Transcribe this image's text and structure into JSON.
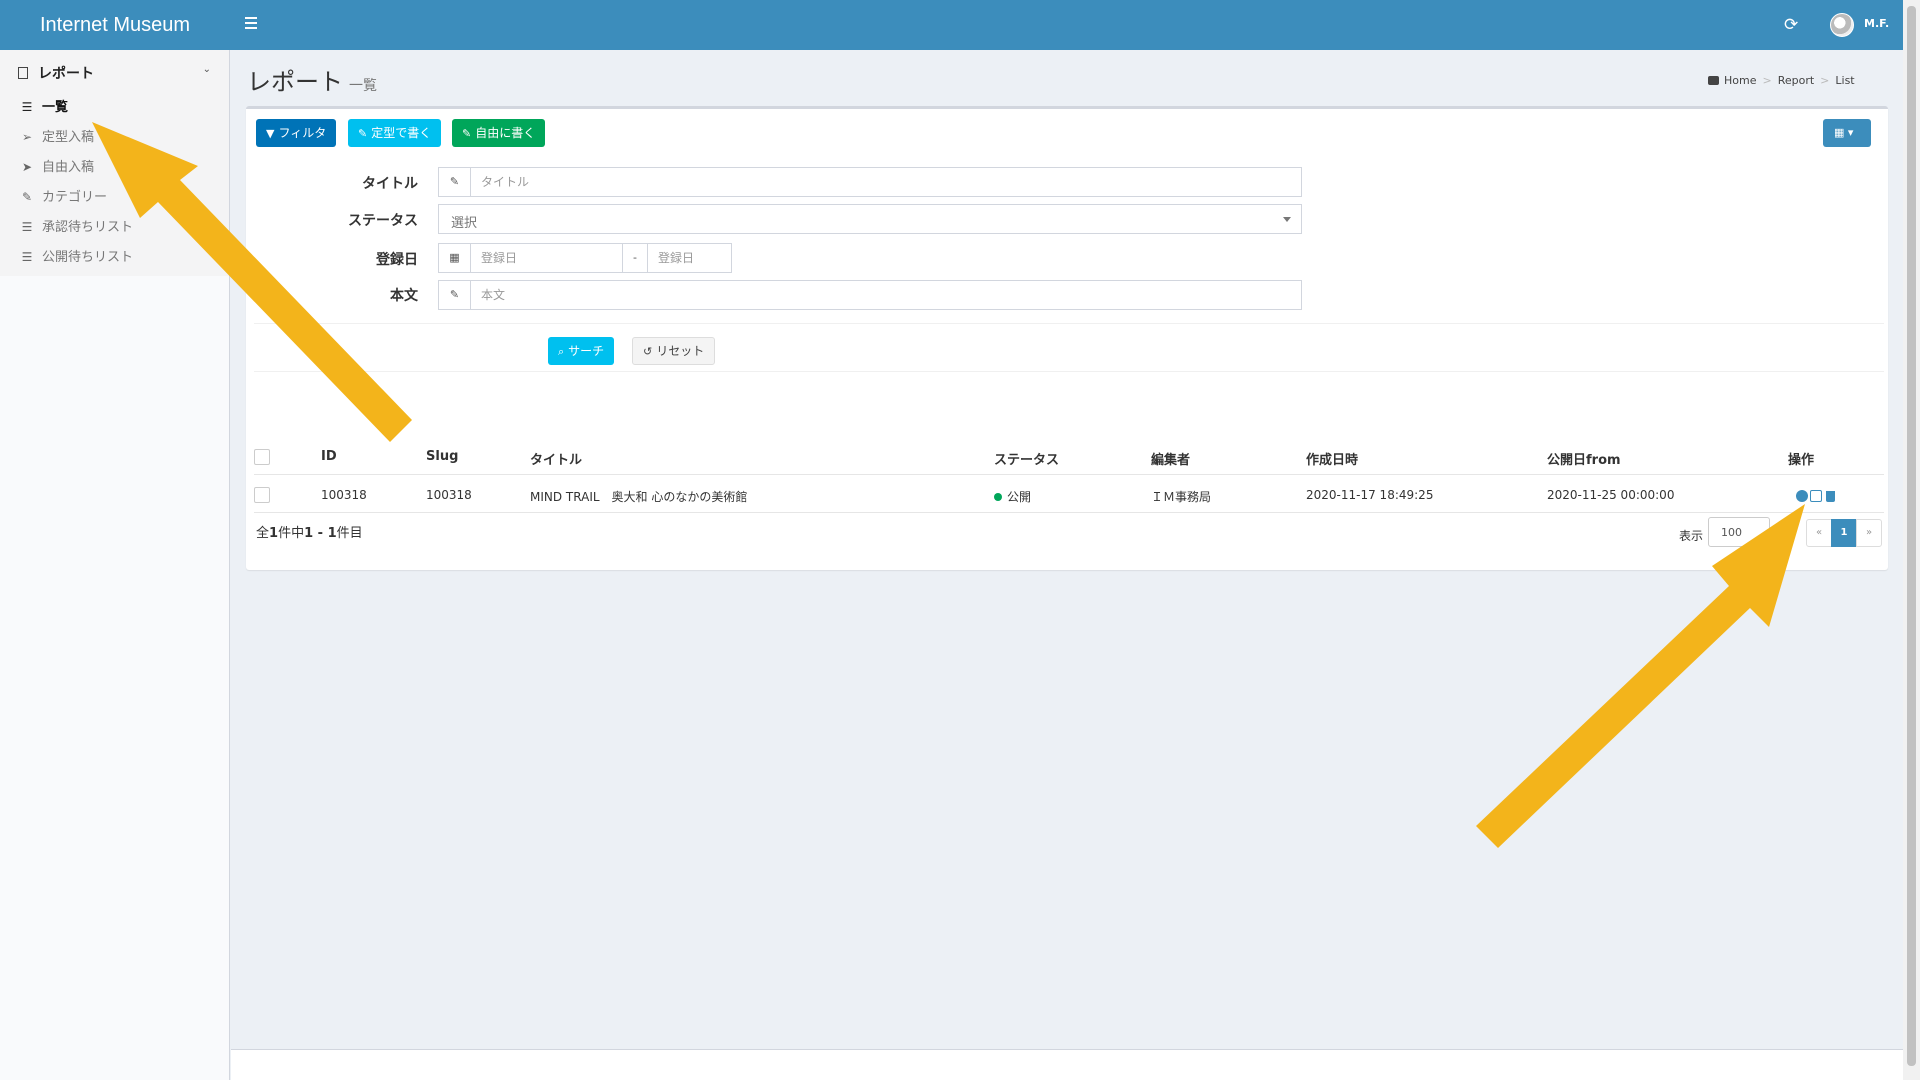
{
  "app": {
    "title": "Internet Museum",
    "user": "M.F."
  },
  "sidebar": {
    "section": "レポート",
    "items": [
      {
        "label": "一覧",
        "icon": "list-icon",
        "active": true
      },
      {
        "label": "定型入稿",
        "icon": "paper-plane-outline-icon"
      },
      {
        "label": "自由入稿",
        "icon": "paper-plane-icon"
      },
      {
        "label": "カテゴリー",
        "icon": "pencil-icon"
      },
      {
        "label": "承認待ちリスト",
        "icon": "list-icon"
      },
      {
        "label": "公開待ちリスト",
        "icon": "list-icon"
      }
    ]
  },
  "page": {
    "title": "レポート",
    "subtitle": "一覧"
  },
  "breadcrumb": [
    "Home",
    "Report",
    "List"
  ],
  "toolbar": {
    "filter": "フィルタ",
    "fixed_write": "定型で書く",
    "free_write": "自由に書く"
  },
  "filter": {
    "title_label": "タイトル",
    "title_placeholder": "タイトル",
    "status_label": "ステータス",
    "status_value": "選択",
    "date_label": "登録日",
    "date_from_placeholder": "登録日",
    "date_sep": "-",
    "date_to_placeholder": "登録日",
    "body_label": "本文",
    "body_placeholder": "本文",
    "search": "サーチ",
    "reset": "リセット"
  },
  "table": {
    "headers": [
      "ID",
      "Slug",
      "タイトル",
      "ステータス",
      "編集者",
      "作成日時",
      "公開日from",
      "操作"
    ],
    "rows": [
      {
        "id": "100318",
        "slug": "100318",
        "title": "MIND TRAIL　奥大和 心のなかの美術館",
        "status": "公開",
        "editor": "ＩＭ事務局",
        "created": "2020-11-17 18:49:25",
        "publish_from": "2020-11-25 00:00:00"
      }
    ]
  },
  "footer": {
    "summary_pre": "全",
    "summary_total": "1",
    "summary_mid": "件中",
    "summary_range": "1 - 1",
    "summary_post": "件目",
    "per_page_label": "表示",
    "per_page": "100",
    "pages": {
      "prev": "«",
      "current": "1",
      "next": "»"
    }
  },
  "colors": {
    "header": "#3c8dbc",
    "filter_btn": "#0073b7",
    "info": "#00c0ef",
    "success": "#00a65a",
    "arrow": "#f3b41b"
  }
}
